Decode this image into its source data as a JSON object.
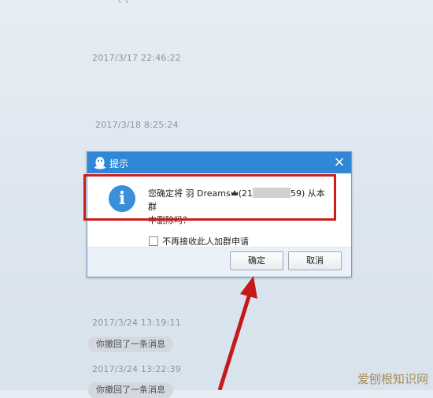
{
  "timestamps": [
    "2017/3/17 22:46:22",
    "2017/3/18 8:25:24",
    "2017/3/24 13:19:11",
    "2017/3/24 13:22:39"
  ],
  "bubbles": [
    "你撤回了一条消息",
    "你撤回了一条消息"
  ],
  "dialog": {
    "title": "提示",
    "close_label": "×",
    "message_part1": "您确定将 羽 Dreams",
    "message_part2": "(21",
    "message_part3": "59) 从本群",
    "message_line2": "中删除吗？",
    "checkbox_label": "不再接收此人加群申请",
    "ok_label": "确定",
    "cancel_label": "取消"
  },
  "watermark": {
    "text": "爱刨根知识网"
  },
  "colors": {
    "title_bar": "#2f87d6",
    "highlight": "#d11c1c",
    "info_icon": "#3a8fd9"
  }
}
